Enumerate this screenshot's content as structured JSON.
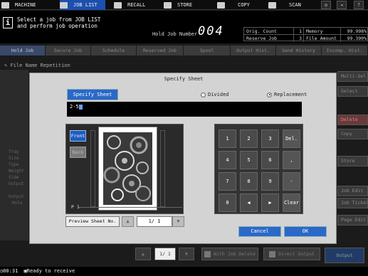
{
  "topnav": {
    "tabs": [
      {
        "label": "MACHINE",
        "icon": "machine-icon"
      },
      {
        "label": "JOB LIST",
        "icon": "job-list-icon",
        "active": true
      },
      {
        "label": "RECALL",
        "icon": "recall-icon"
      },
      {
        "label": "STORE",
        "icon": "store-icon"
      },
      {
        "label": "COPY",
        "icon": "copy-icon"
      },
      {
        "label": "SCAN",
        "icon": "scan-icon"
      }
    ],
    "right_icons": [
      "globe-icon",
      "volume-icon",
      "help-icon"
    ]
  },
  "header": {
    "msg_line1": "Select a job from JOB LIST",
    "msg_line2": "and perform job operation",
    "hold_job_label": "Hold Job Number",
    "hold_job_value": "004"
  },
  "status": {
    "orig_count_label": "Orig. Count",
    "orig_count_value": "1",
    "memory_label": "Memory",
    "memory_value": "99.998%",
    "reserve_job_label": "Reserve Job",
    "reserve_job_value": "3",
    "file_amount_label": "File Amount",
    "file_amount_value": "99.390%"
  },
  "subtabs": [
    "Hold Job",
    "Secure Job",
    "Schedule",
    "Reserved Job",
    "Spool",
    "Output Hist.",
    "Send History",
    "Incomp. Hist."
  ],
  "file_name_repetition": "File Name Repetition",
  "background": {
    "right_buttons": [
      "Multi-Sel",
      "Select",
      "Delete",
      "Copy",
      "Store",
      "Job Edit",
      "Job Ticket",
      "Page Edit",
      "Output"
    ],
    "left_labels": [
      "Tray",
      "Size",
      "Type",
      "Weight",
      "Side",
      "Output",
      "Output",
      "Hole"
    ],
    "page_indicator": "1/ 1",
    "with_job_delete": "With Job Delete",
    "direct_output": "Direct Output",
    "output_btn": "Output"
  },
  "dialog": {
    "title": "Specify Sheet",
    "specify_sheet_btn": "Specify Sheet",
    "divided_label": "Divided",
    "replacement_label": "Replacement",
    "input_value": "2-5",
    "front_label": "Front",
    "back_label": "Back",
    "page_label": "P 1",
    "preview_sheet_btn": "Preview Sheet No.",
    "page_value": "1/ 1",
    "keys": [
      "1",
      "2",
      "3",
      "4",
      "5",
      "6",
      "7",
      "8",
      "9",
      "0",
      "◀",
      "▶"
    ],
    "side_keys": [
      "Del.",
      ",",
      "-",
      "Clear"
    ],
    "cancel_label": "Cancel",
    "ok_label": "OK"
  },
  "status_bar": {
    "time": "00:31",
    "message": "Ready to receive"
  }
}
